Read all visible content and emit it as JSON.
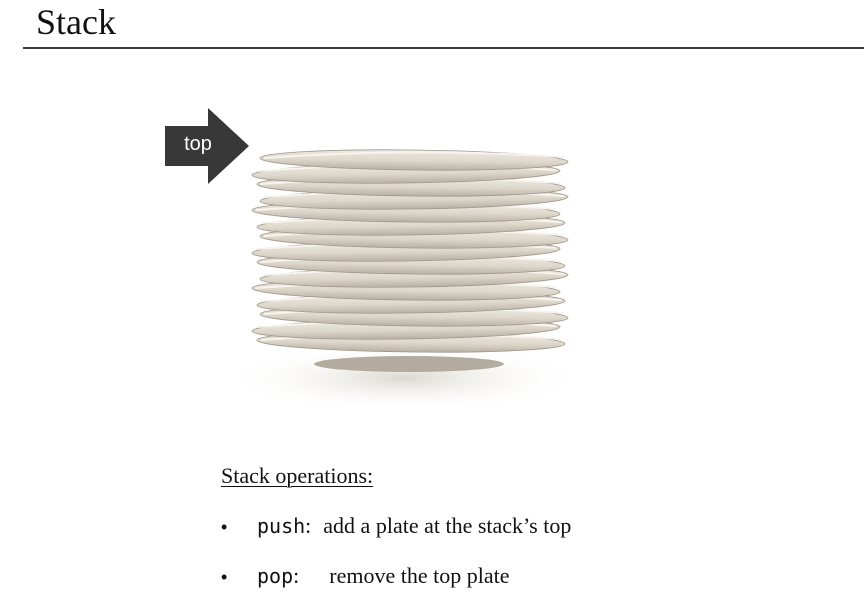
{
  "slide": {
    "title": "Stack"
  },
  "image": {
    "arrow_label": "top",
    "arrow_color": "#383838"
  },
  "operations": {
    "heading": "Stack operations:",
    "items": [
      {
        "bullet": "•",
        "name": "push",
        "sep": ":",
        "desc": "add a plate at the stack’s top"
      },
      {
        "bullet": "•",
        "name": "pop",
        "sep": ":",
        "desc": "remove the top plate"
      }
    ]
  }
}
